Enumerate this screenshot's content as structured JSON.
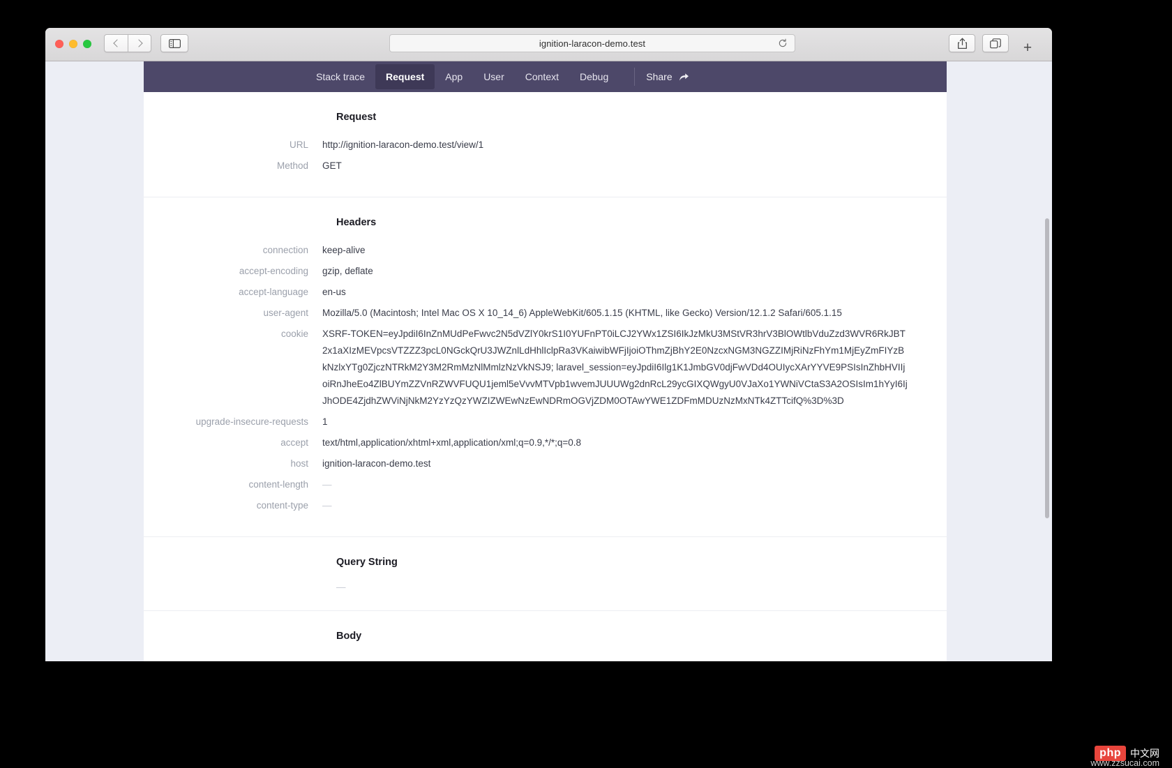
{
  "browser": {
    "url_text": "ignition-laracon-demo.test",
    "reload_icon": "reload-icon",
    "back_icon": "chevron-left-icon",
    "forward_icon": "chevron-right-icon",
    "sidebar_icon": "sidebar-icon",
    "share_icon": "share-icon",
    "tabs_icon": "tabs-icon",
    "newtab_label": "+"
  },
  "ignition": {
    "tabs": [
      {
        "label": "Stack trace",
        "active": false
      },
      {
        "label": "Request",
        "active": true
      },
      {
        "label": "App",
        "active": false
      },
      {
        "label": "User",
        "active": false
      },
      {
        "label": "Context",
        "active": false
      },
      {
        "label": "Debug",
        "active": false
      }
    ],
    "share_label": "Share",
    "share_arrow_icon": "share-arrow-icon",
    "sections": {
      "request": {
        "title": "Request",
        "rows": [
          {
            "key": "URL",
            "value": "http://ignition-laracon-demo.test/view/1"
          },
          {
            "key": "Method",
            "value": "GET"
          }
        ]
      },
      "headers": {
        "title": "Headers",
        "rows": [
          {
            "key": "connection",
            "value": "keep-alive"
          },
          {
            "key": "accept-encoding",
            "value": "gzip, deflate"
          },
          {
            "key": "accept-language",
            "value": "en-us"
          },
          {
            "key": "user-agent",
            "value": "Mozilla/5.0 (Macintosh; Intel Mac OS X 10_14_6) AppleWebKit/605.1.15 (KHTML, like Gecko) Version/12.1.2 Safari/605.1.15"
          },
          {
            "key": "cookie",
            "value": "XSRF-TOKEN=eyJpdiI6InZnMUdPeFwvc2N5dVZlY0krS1I0YUFnPT0iLCJ2YWx1ZSI6IkJzMkU3MStVR3hrV3BlOWtlbVduZzd3WVR6RkJBT2x1aXIzMEVpcsVTZZZ3pcL0NGckQrU3JWZnlLdHhlIclpRa3VKaiwibWFjIjoiOThmZjBhY2E0NzcxNGM3NGZZIMjRiNzFhYm1MjEyZmFIYzBkNzlxYTg0ZjczNTRkM2Y3M2RmMzNlMmlzNzVkNSJ9; laravel_session=eyJpdiI6Ilg1K1JmbGV0djFwVDd4OUIycXArYYVE9PSIsInZhbHVIIjoiRnJheEo4ZlBUYmZZVnRZWVFUQU1jeml5eVvvMTVpb1wvemJUUUWg2dnRcL29ycGIXQWgyU0VJaXo1YWNiVCtaS3A2OSIsIm1hYyI6IjJhODE4ZjdhZWViNjNkM2YzYzQzYWZIZWEwNzEwNDRmOGVjZDM0OTAwYWE1ZDFmMDUzNzMxNTk4ZTTcifQ%3D%3D"
          },
          {
            "key": "upgrade-insecure-requests",
            "value": "1"
          },
          {
            "key": "accept",
            "value": "text/html,application/xhtml+xml,application/xml;q=0.9,*/*;q=0.8"
          },
          {
            "key": "host",
            "value": "ignition-laracon-demo.test"
          },
          {
            "key": "content-length",
            "value": "—"
          },
          {
            "key": "content-type",
            "value": "—"
          }
        ]
      },
      "query_string": {
        "title": "Query String",
        "empty_value": "—"
      },
      "body": {
        "title": "Body",
        "empty_value": "—"
      }
    }
  },
  "watermark": {
    "badge": "php",
    "cn_text": "中文网",
    "url": "www.zzsucai.com"
  }
}
